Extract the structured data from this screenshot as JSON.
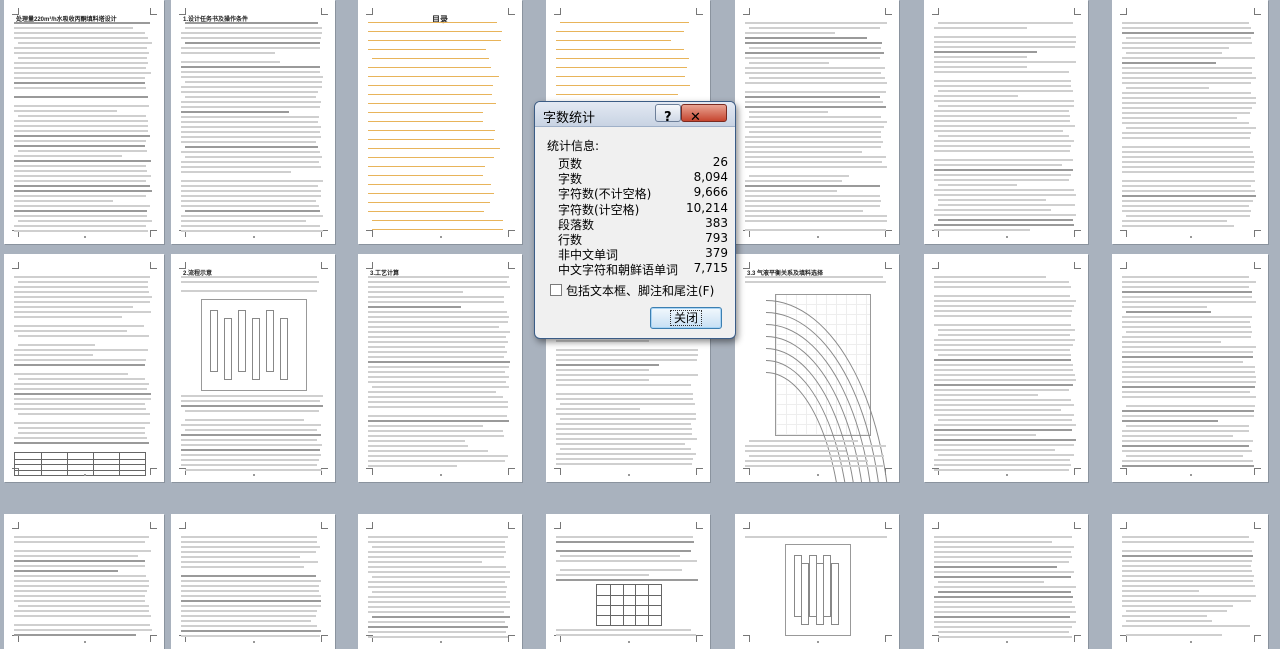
{
  "thumb_titles": [
    "处理量220m³/h水吸收丙酮填料塔设计",
    "1.设计任务书及操作条件",
    "目录",
    "",
    "",
    "",
    "",
    "",
    "2.流程示意",
    "3.工艺计算",
    "",
    "3.3 气液平衡关系及填料选择",
    "",
    "",
    "",
    "",
    "",
    "",
    "",
    "",
    ""
  ],
  "dialog": {
    "title": "字数统计",
    "help_label": "?",
    "close_icon_label": "✕",
    "section_label": "统计信息:",
    "stats": [
      {
        "label": "页数",
        "value": "26"
      },
      {
        "label": "字数",
        "value": "8,094"
      },
      {
        "label": "字符数(不计空格)",
        "value": "9,666"
      },
      {
        "label": "字符数(计空格)",
        "value": "10,214"
      },
      {
        "label": "段落数",
        "value": "383"
      },
      {
        "label": "行数",
        "value": "793"
      },
      {
        "label": "非中文单词",
        "value": "379"
      },
      {
        "label": "中文字符和朝鲜语单词",
        "value": "7,715"
      }
    ],
    "checkbox_label": "包括文本框、脚注和尾注(F)",
    "close_button_label": "关闭"
  }
}
